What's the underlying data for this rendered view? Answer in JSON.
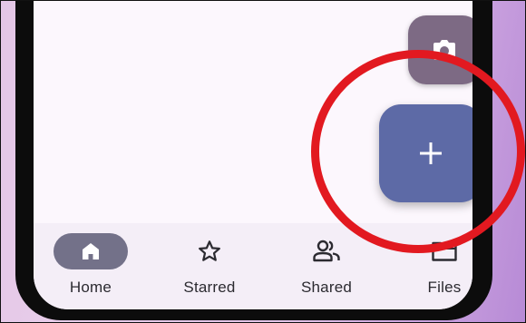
{
  "bottom_nav": {
    "items": [
      {
        "label": "Home",
        "icon": "home-icon",
        "active": true
      },
      {
        "label": "Starred",
        "icon": "star-icon",
        "active": false
      },
      {
        "label": "Shared",
        "icon": "people-icon",
        "active": false
      },
      {
        "label": "Files",
        "icon": "folder-icon",
        "active": false
      }
    ]
  },
  "fab": {
    "main_icon": "plus-icon",
    "secondary_icon": "camera-icon"
  },
  "colors": {
    "fab_main": "#5d6aa6",
    "fab_secondary": "#7d6a84",
    "nav_active_pill": "#737189",
    "highlight_circle": "#e21920"
  }
}
